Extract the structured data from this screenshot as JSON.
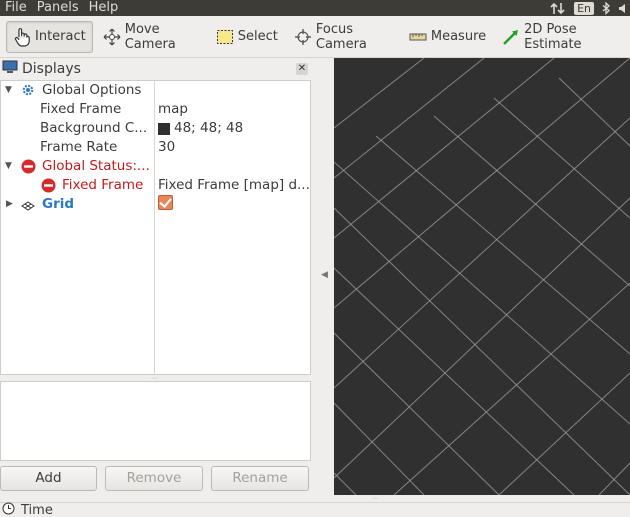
{
  "menubar": {
    "items": [
      "File",
      "Panels",
      "Help"
    ],
    "tray": {
      "language": "En"
    }
  },
  "toolbar": {
    "tools": [
      {
        "label": "Interact",
        "icon": "hand-pointer-icon",
        "active": true
      },
      {
        "label": "Move Camera",
        "icon": "move-arrows-icon"
      },
      {
        "label": "Select",
        "icon": "selection-box-icon"
      },
      {
        "label": "Focus Camera",
        "icon": "crosshair-icon"
      },
      {
        "label": "Measure",
        "icon": "ruler-icon"
      },
      {
        "label": "2D Pose Estimate",
        "icon": "green-arrow-icon"
      }
    ]
  },
  "displays": {
    "title": "Displays",
    "tree": [
      {
        "name": "Global Options",
        "value": ""
      },
      {
        "name": "Fixed Frame",
        "value": "map"
      },
      {
        "name": "Background C...",
        "value": "48; 48; 48"
      },
      {
        "name": "Frame Rate",
        "value": "30"
      },
      {
        "name": "Global Status:...",
        "value": ""
      },
      {
        "name": "Fixed Frame",
        "value": "Fixed Frame [map] d..."
      },
      {
        "name": "Grid",
        "value": ""
      }
    ],
    "buttons": {
      "add": "Add",
      "remove": "Remove",
      "rename": "Rename"
    }
  },
  "colors": {
    "background_swatch": "#303030",
    "error": "#c01c1c",
    "grid_name": "#2a79c8",
    "checkbox": "#e7875a",
    "view_bg": "#303030",
    "grid_lines": "#a0a0a0"
  },
  "time_panel": {
    "title": "Time"
  }
}
